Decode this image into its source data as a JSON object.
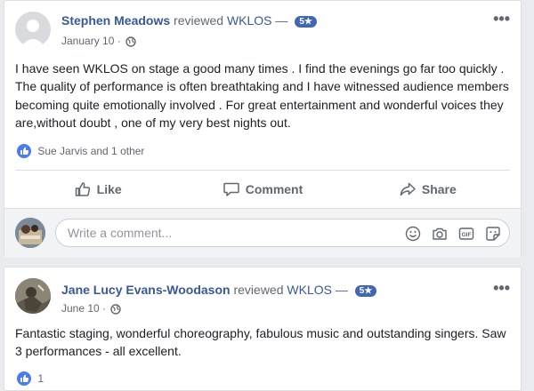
{
  "reviews": [
    {
      "author": "Stephen Meadows",
      "action": "reviewed",
      "page": "WKLOS",
      "dash": "—",
      "rating_badge": "5★",
      "date": "January 10 ·",
      "text": "I have seen WKLOS on stage a good many times . I find the evenings go far too quickly . The quality of performance is often breathtaking and I have witnessed audience members becoming quite emotionally involved . For great entertainment and wonderful voices they are,without doubt , one of my very best nights out.",
      "likes_text": "Sue Jarvis and 1 other",
      "actions": [
        "Like",
        "Comment",
        "Share"
      ],
      "comment_placeholder": "Write a comment..."
    },
    {
      "author": "Jane Lucy Evans-Woodason",
      "action": "reviewed",
      "page": "WKLOS",
      "dash": "—",
      "rating_badge": "5★",
      "date": "June 10 ·",
      "text": "Fantastic staging, wonderful choreography, fabulous music and outstanding singers. Saw 3 performances - all excellent.",
      "likes_text": "1"
    }
  ],
  "more_menu": "•••",
  "colors": {
    "link": "#385898",
    "badge": "#4267b2",
    "like": "#4a7bf0"
  },
  "icons": [
    "globe-icon",
    "like-icon",
    "comment-icon",
    "share-icon",
    "emoji-icon",
    "camera-icon",
    "gif-icon",
    "sticker-icon",
    "more-options-icon"
  ]
}
